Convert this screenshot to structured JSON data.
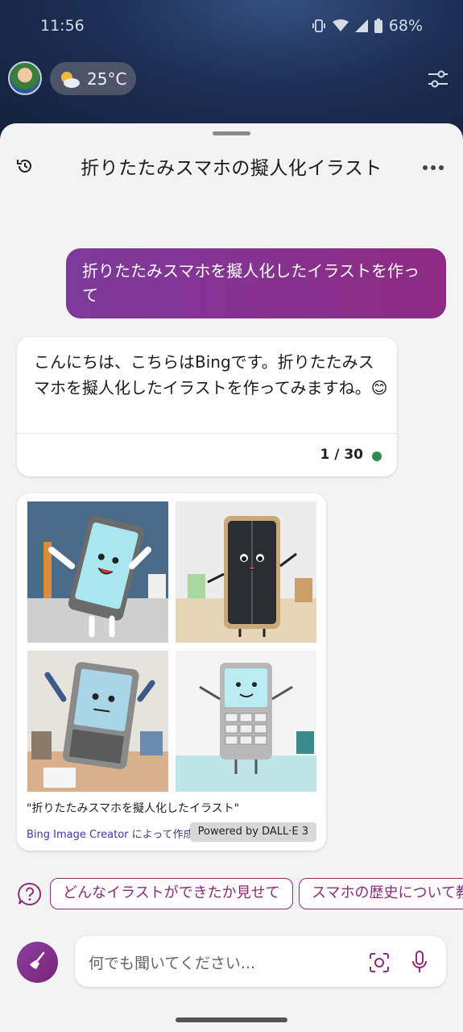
{
  "status": {
    "time": "11:56",
    "battery": "68%"
  },
  "weather": {
    "temperature": "25°C"
  },
  "sheet": {
    "title": "折りたたみスマホの擬人化イラスト"
  },
  "chat": {
    "user_message": "折りたたみスマホを擬人化したイラストを作って",
    "bot_message": "こんにちは、こちらはBingです。折りたたみスマホを擬人化したイラストを作ってみますね。😊",
    "counter": "1 / 30"
  },
  "image_card": {
    "caption": "\"折りたたみスマホを擬人化したイラスト\"",
    "creator_link": "Bing Image Creator によって作成",
    "badge": "Powered by DALL·E 3"
  },
  "suggestions": [
    {
      "label": "どんなイラストができたか見せて"
    },
    {
      "label": "スマホの歴史について教"
    }
  ],
  "composer": {
    "placeholder": "何でも聞いてください..."
  },
  "colors": {
    "accent": "#8e2a7a",
    "user_bubble": "#7d3a9a",
    "status_dot": "#2e8b4a"
  }
}
